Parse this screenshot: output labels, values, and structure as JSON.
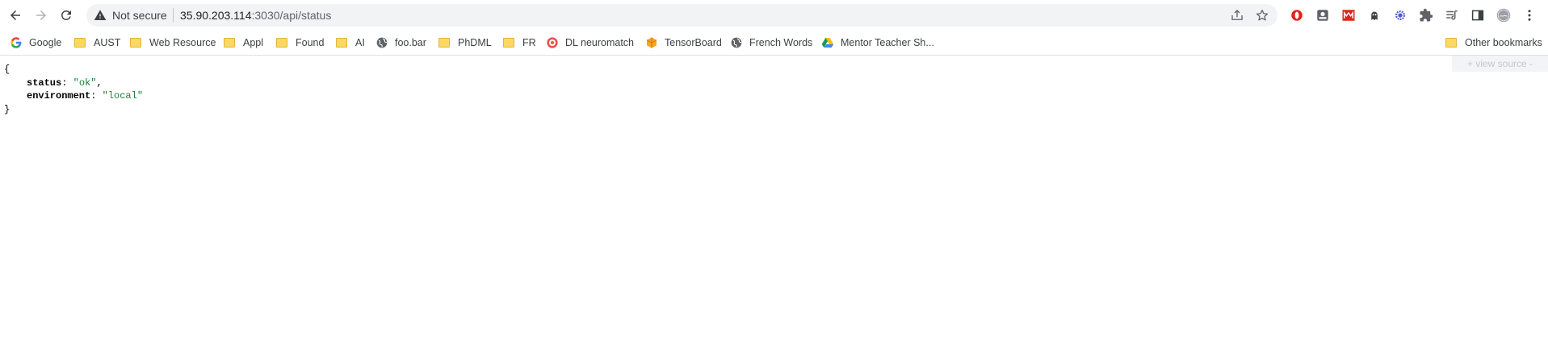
{
  "omnibox": {
    "security_label": "Not secure",
    "url_host": "35.90.203.114",
    "url_path": ":3030/api/status"
  },
  "toolbar": {
    "back_icon": "arrow-left-icon",
    "forward_icon": "arrow-right-icon",
    "reload_icon": "reload-icon"
  },
  "extensions": [
    {
      "name": "opera-extension",
      "color": "#e2231a"
    },
    {
      "name": "ext-gray-square",
      "color": "#5f6368"
    },
    {
      "name": "ext-red-m",
      "color": "#e2231a"
    },
    {
      "name": "ext-ghost",
      "color": "#3c4043"
    },
    {
      "name": "ext-blue-gear",
      "color": "#4c5bd4"
    },
    {
      "name": "extensions-puzzle",
      "color": "#5f6368"
    },
    {
      "name": "reading-list",
      "color": "#5f6368"
    },
    {
      "name": "side-panel",
      "color": "#5f6368"
    },
    {
      "name": "profile-avatar",
      "color": "#9aa0a6"
    },
    {
      "name": "menu-kebab",
      "color": "#3c4043"
    }
  ],
  "bookmarks": [
    {
      "label": "Google",
      "icon": "google-icon"
    },
    {
      "label": "AUST",
      "icon": "folder-icon"
    },
    {
      "label": "Web Resource",
      "icon": "folder-icon"
    },
    {
      "label": "Appl",
      "icon": "folder-icon"
    },
    {
      "label": "Found",
      "icon": "folder-icon"
    },
    {
      "label": "AI",
      "icon": "folder-icon"
    },
    {
      "label": "foo.bar",
      "icon": "globe-icon"
    },
    {
      "label": "PhDML",
      "icon": "folder-icon"
    },
    {
      "label": "FR",
      "icon": "folder-icon"
    },
    {
      "label": "DL neuromatch",
      "icon": "neuromatch-icon"
    },
    {
      "label": "TensorBoard",
      "icon": "tensorboard-icon"
    },
    {
      "label": "French Words",
      "icon": "globe-icon"
    },
    {
      "label": "Mentor Teacher Sh...",
      "icon": "google-drive-icon"
    }
  ],
  "other_bookmarks": {
    "label": "Other bookmarks",
    "icon": "folder-icon"
  },
  "json_viewer": {
    "open_brace": "{",
    "close_brace": "}",
    "entries": [
      {
        "key": "status",
        "value": "\"ok\"",
        "trailing": ","
      },
      {
        "key": "environment",
        "value": "\"local\"",
        "trailing": ""
      }
    ],
    "view_source_label": "+ view source -"
  }
}
